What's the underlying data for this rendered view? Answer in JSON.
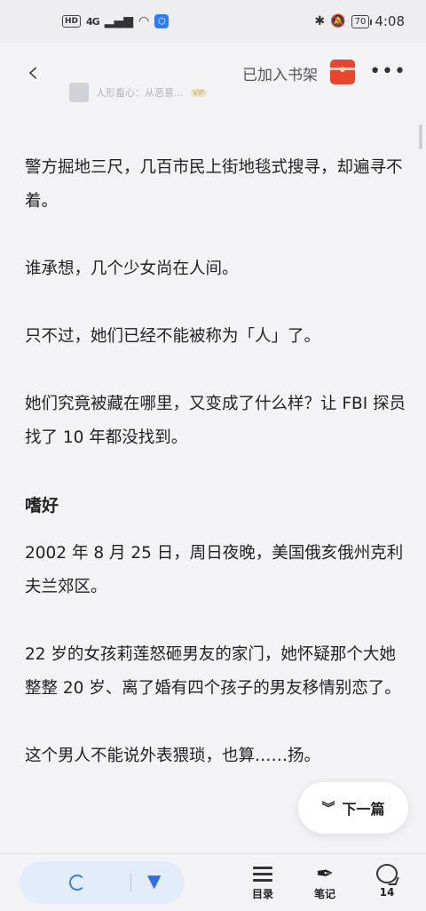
{
  "status_bar": {
    "hd": "HD",
    "signal": "4G",
    "vpn": "VPN",
    "battery": "70",
    "time": "4:08"
  },
  "top_bar": {
    "back_icon": "chevron-left-icon",
    "bookshelf_label": "已加入书架",
    "gift_icon": "red-envelope-icon",
    "more_icon": "more-dots-icon",
    "more_glyph": "•••",
    "mini_card": {
      "title": "人形畜心：从恶意...",
      "badge": "VIP"
    }
  },
  "article": {
    "paragraphs_before": [
      "警方掘地三尺，几百市民上街地毯式搜寻，却遍寻不着。",
      "谁承想，几个少女尚在人间。",
      "只不过，她们已经不能被称为「人」了。",
      "她们究竟被藏在哪里，又变成了什么样？让 FBI 探员找了 10 年都没找到。"
    ],
    "section_heading": "嗜好",
    "paragraphs_after": [
      "2002 年 8 月 25 日，周日夜晚，美国俄亥俄州克利夫兰郊区。",
      "22 岁的女孩莉莲怒砸男友的家门，她怀疑那个大她整整 20 岁、离了婚有四个孩子的男友移情别恋了。",
      "这个男人不能说外表猥琐，也算……扬。"
    ]
  },
  "next_article": {
    "icon": "double-chevron-down-icon",
    "label": "下一篇"
  },
  "bottom_bar": {
    "audio_loading_icon": "loading-icon",
    "audio_expand_icon": "triangle-down-icon",
    "toc_label": "目录",
    "note_label": "笔记",
    "comment_count": "14"
  },
  "colors": {
    "accent_blue": "#2f6fe6",
    "page_bg": "#f3f3f5",
    "gift_red": "#e8452c"
  }
}
